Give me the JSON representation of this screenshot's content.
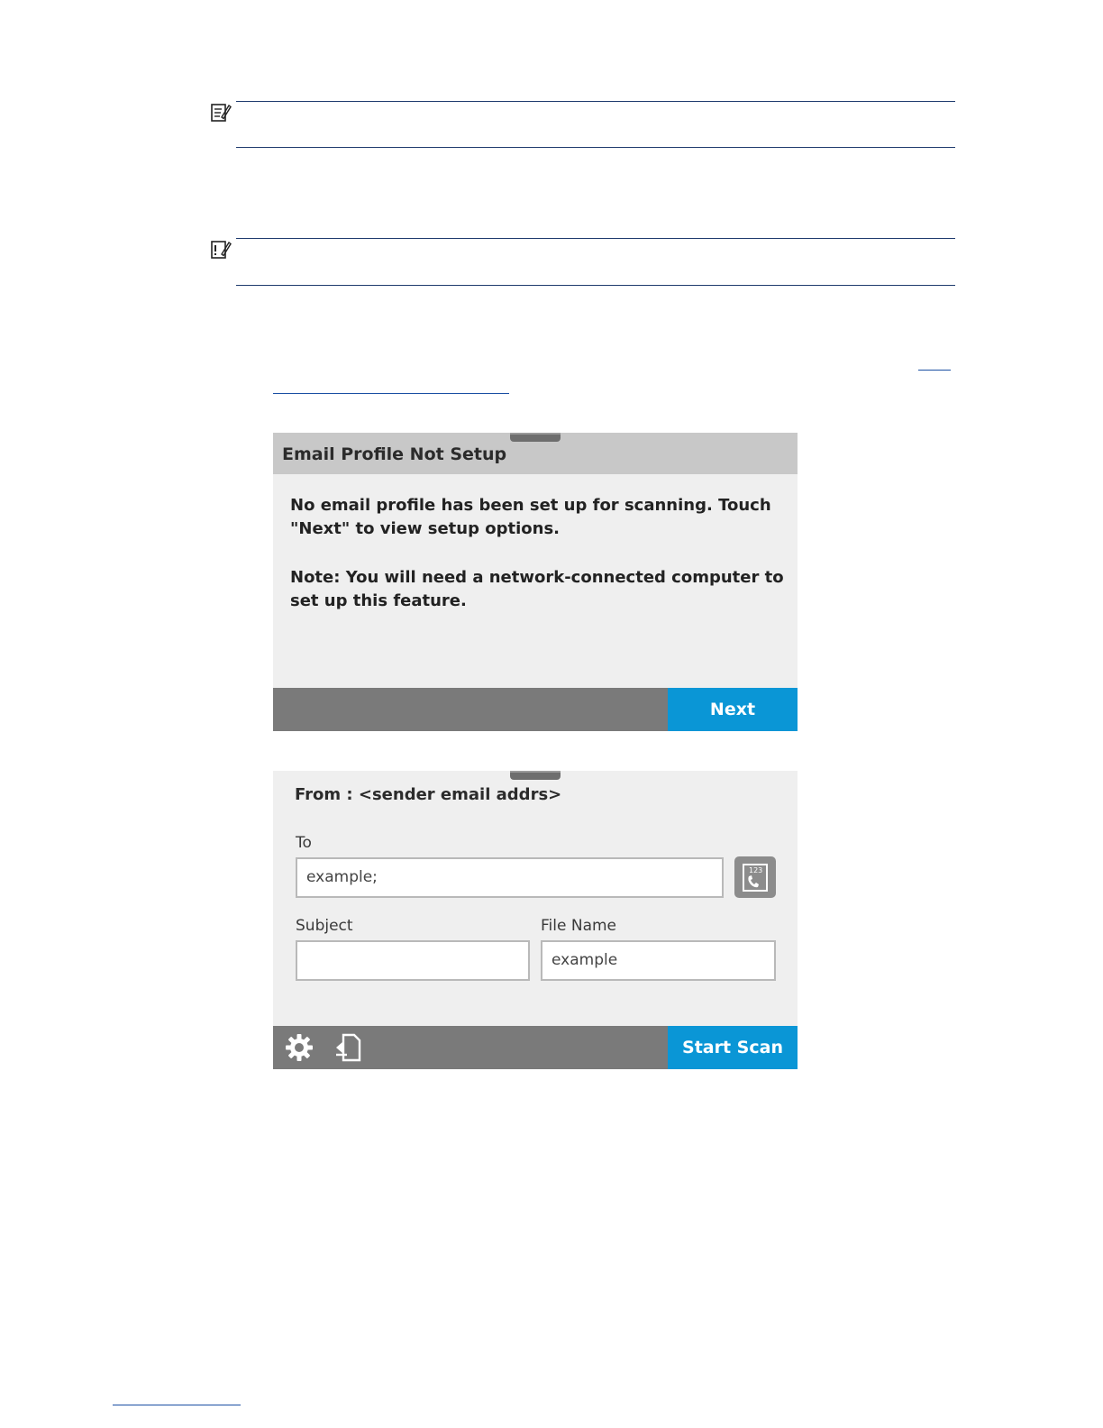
{
  "email_profile_dialog": {
    "title": "Email Profile Not Setup",
    "message": "No email profile has been set up for scanning. Touch \"Next\" to view setup options.",
    "note": "Note: You will need a network-connected computer to set up this feature.",
    "next_label": "Next"
  },
  "scan_to_email_screen": {
    "from_label": "From : <sender email addrs>",
    "to_label": "To",
    "to_value": "example;",
    "subject_label": "Subject",
    "subject_value": "",
    "filename_label": "File Name",
    "filename_value": "example",
    "start_scan_label": "Start Scan",
    "icons": {
      "address_book": "address-book-icon",
      "settings": "gear-icon",
      "preview": "document-preview-icon"
    }
  },
  "colors": {
    "accent": "#0a96d6",
    "footer": "#7a7a7a",
    "title_bar": "#c8c8c8",
    "panel_bg": "#efefef"
  }
}
